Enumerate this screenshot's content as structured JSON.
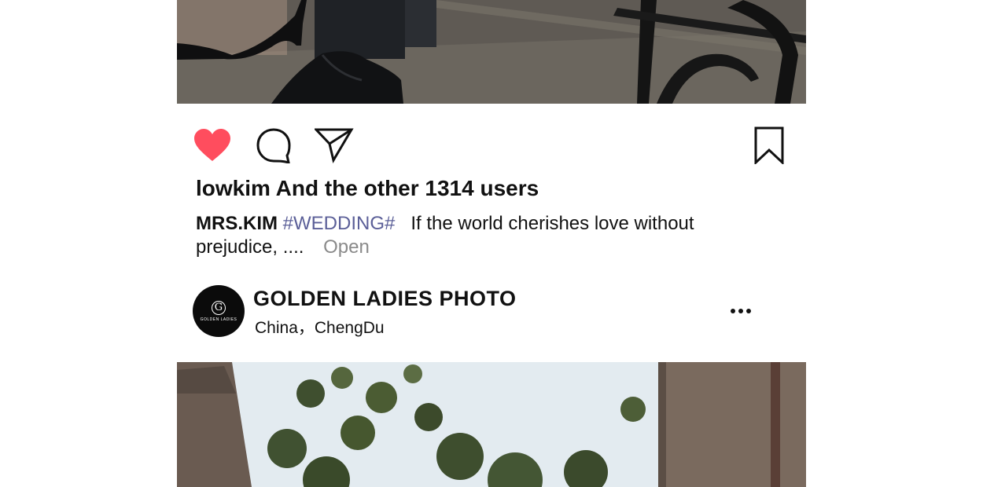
{
  "post": {
    "likes_text": "lowkim And the other 1314 users",
    "caption": {
      "user": "MRS.KIM",
      "hashtag": "#WEDDING#",
      "text": "If the world cherishes love without prejudice, ....",
      "open_label": "Open"
    },
    "actions": {
      "like_icon": "heart-icon",
      "comment_icon": "comment-icon",
      "share_icon": "send-icon",
      "save_icon": "bookmark-icon",
      "like_color": "#ff4d5e"
    }
  },
  "author": {
    "name": "GOLDEN LADIES PHOTO",
    "location": "China，ChengDu",
    "avatar_text": "GOLDEN LADIES",
    "avatar_mark": "G",
    "more_icon": "more-options-icon"
  },
  "colors": {
    "hashtag": "#5b5f98",
    "open": "#8a8a8a",
    "text": "#111111"
  }
}
